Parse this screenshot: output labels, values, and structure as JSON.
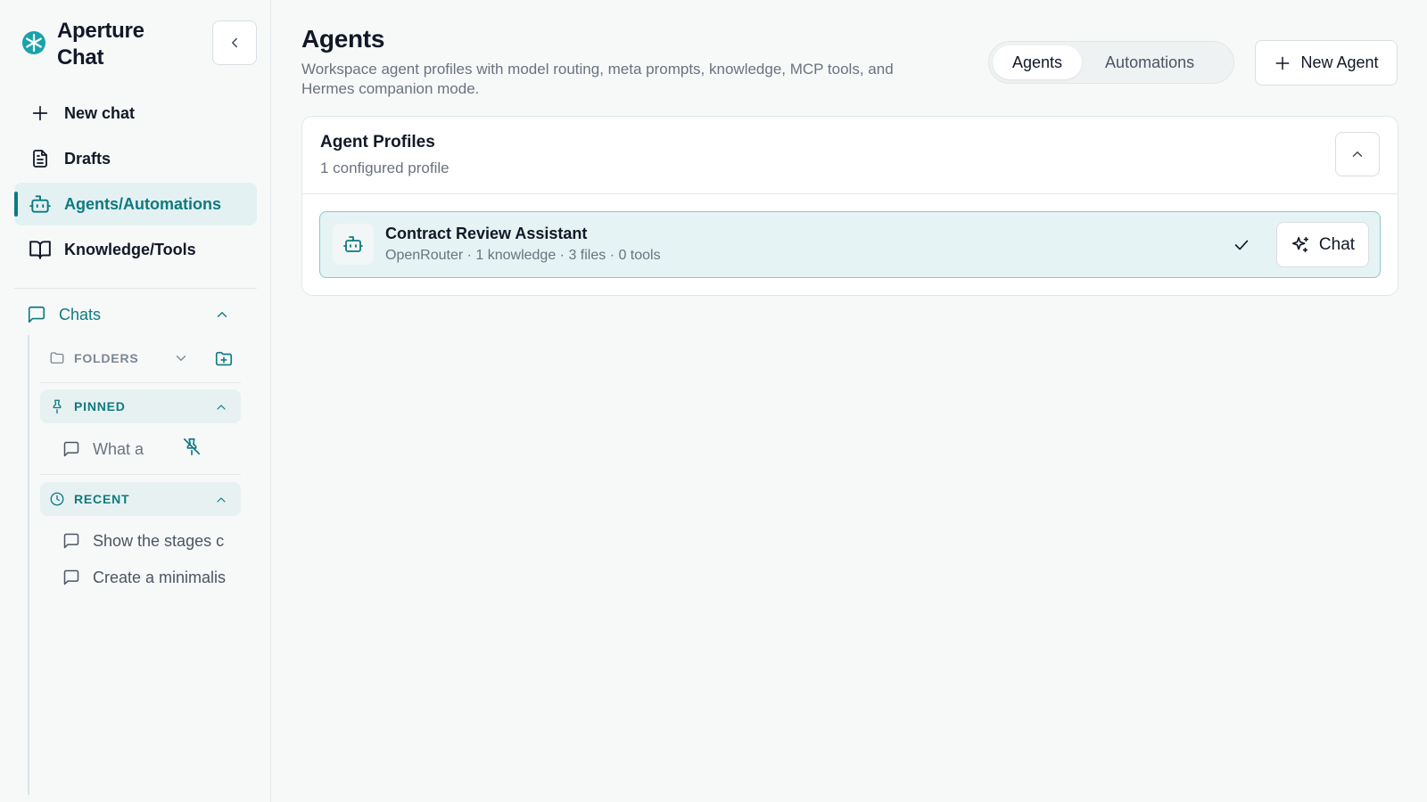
{
  "app": {
    "name": "Aperture Chat",
    "accent_color": "#0e7a80"
  },
  "sidebar": {
    "nav": [
      {
        "label": "New chat",
        "icon": "plus-icon"
      },
      {
        "label": "Drafts",
        "icon": "document-icon"
      },
      {
        "label": "Agents/Automations",
        "icon": "robot-icon",
        "active": true
      },
      {
        "label": "Knowledge/Tools",
        "icon": "book-icon"
      }
    ],
    "chats_label": "Chats",
    "folders_label": "FOLDERS",
    "pinned_label": "PINNED",
    "recent_label": "RECENT",
    "pinned_chats": [
      "What a"
    ],
    "recent_chats": [
      "Show the stages c",
      "Create a minimalis"
    ]
  },
  "main": {
    "title": "Agents",
    "subtitle": "Workspace agent profiles with model routing, meta prompts, knowledge, MCP tools, and Hermes companion mode.",
    "tabs": [
      {
        "label": "Agents",
        "active": true
      },
      {
        "label": "Automations",
        "active": false
      }
    ],
    "new_agent_label": "New Agent",
    "section": {
      "title": "Agent Profiles",
      "subtitle": "1 configured profile"
    },
    "profiles": [
      {
        "name": "Contract Review Assistant",
        "meta": "OpenRouter · 1 knowledge · 3 files · 0 tools",
        "selected": true,
        "chat_label": "Chat"
      }
    ]
  }
}
